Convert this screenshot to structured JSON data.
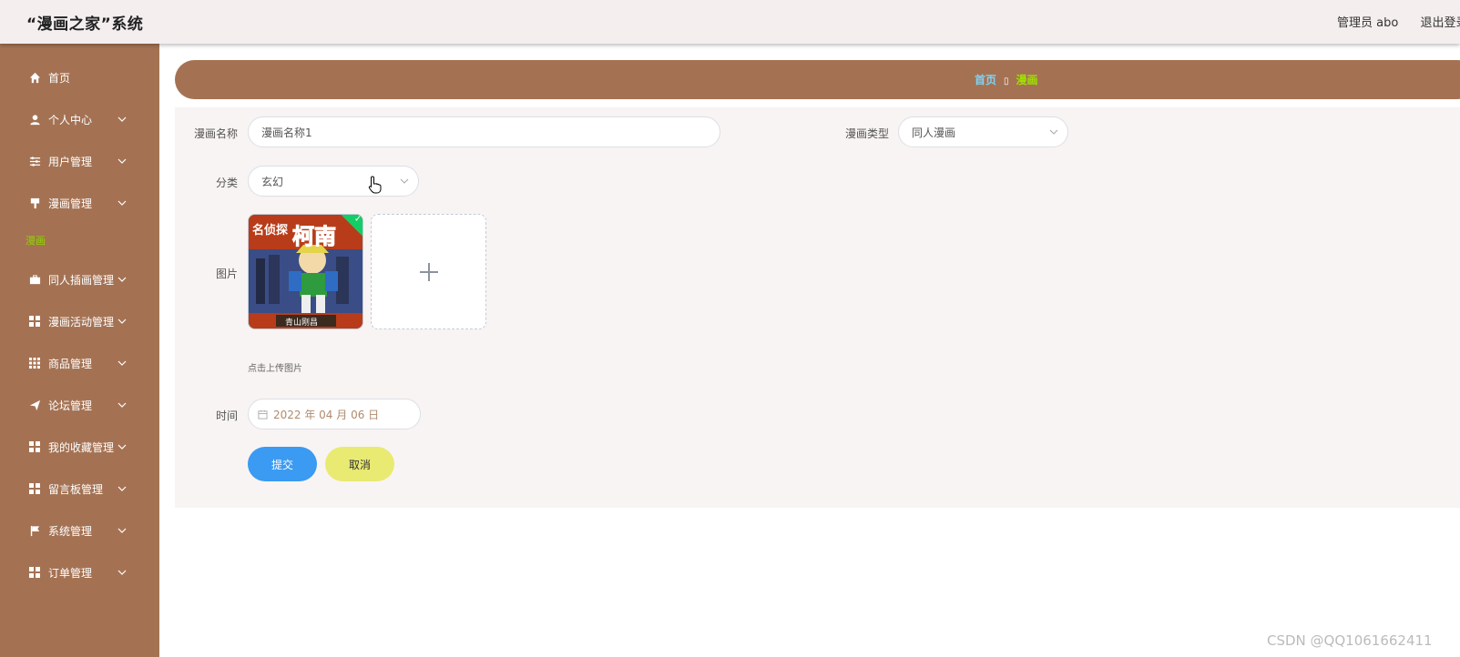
{
  "header": {
    "title": "“漫画之家”系统",
    "user": "管理员 abo",
    "logout": "退出登录"
  },
  "sidebar": {
    "items": [
      {
        "label": "首页",
        "icon": "home-icon"
      },
      {
        "label": "个人中心",
        "icon": "user-icon"
      },
      {
        "label": "用户管理",
        "icon": "sliders-icon"
      },
      {
        "label": "漫画管理",
        "icon": "brush-icon"
      },
      {
        "label": "同人插画管理",
        "icon": "briefcase-icon"
      },
      {
        "label": "漫画活动管理",
        "icon": "grid-icon"
      },
      {
        "label": "商品管理",
        "icon": "apps-icon"
      },
      {
        "label": "论坛管理",
        "icon": "send-icon"
      },
      {
        "label": "我的收藏管理",
        "icon": "grid-icon"
      },
      {
        "label": "留言板管理",
        "icon": "grid-icon"
      },
      {
        "label": "系统管理",
        "icon": "flag-icon"
      },
      {
        "label": "订单管理",
        "icon": "grid-icon"
      }
    ],
    "active_sub": "漫画"
  },
  "breadcrumb": {
    "home": "首页",
    "separator": "▯",
    "current": "漫画"
  },
  "form": {
    "name_label": "漫画名称",
    "name_value": "漫画名称1",
    "type_label": "漫画类型",
    "type_value": "同人漫画",
    "category_label": "分类",
    "category_value": "玄幻",
    "image_label": "图片",
    "upload_tip": "点击上传图片",
    "time_label": "时间",
    "time_value": "2022 年 04 月 06 日",
    "submit": "提交",
    "cancel": "取消"
  },
  "thumbnail": {
    "top_text": "名侦探",
    "big_text": "柯南",
    "author": "青山刚昌"
  },
  "watermark": "CSDN @QQ1061662411",
  "colors": {
    "sidebar": "#a47253",
    "submit": "#3b9af2",
    "cancel": "#e9ea72",
    "success": "#13ce66"
  }
}
